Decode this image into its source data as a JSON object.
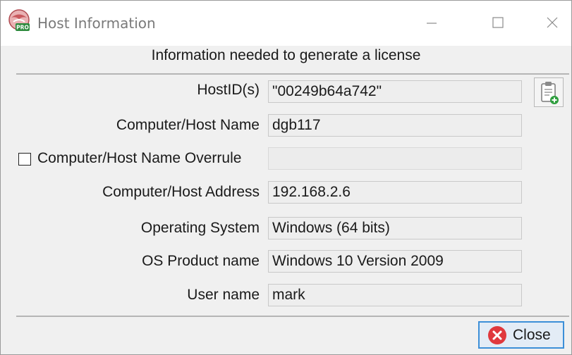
{
  "window": {
    "title": "Host Information",
    "app_icon_badge": "PRO"
  },
  "subtitle": "Information needed to generate a license",
  "fields": {
    "hostid": {
      "label": "HostID(s)",
      "value": "\"00249b64a742\""
    },
    "hostname": {
      "label": "Computer/Host Name",
      "value": "dgb117"
    },
    "overrule": {
      "label": "Computer/Host Name Overrule",
      "value": "",
      "checked": false
    },
    "address": {
      "label": "Computer/Host Address",
      "value": "192.168.2.6"
    },
    "os": {
      "label": "Operating System",
      "value": "Windows (64 bits)"
    },
    "product": {
      "label": "OS Product name",
      "value": "Windows 10 Version 2009"
    },
    "user": {
      "label": "User name",
      "value": "mark"
    }
  },
  "buttons": {
    "copy_icon": "clipboard-add-icon",
    "close_label": "Close",
    "close_icon": "close-x-icon"
  },
  "colors": {
    "close_icon_red": "#e0393e",
    "close_border": "#3c8fd8",
    "copy_plus_green": "#2e9e3e"
  }
}
